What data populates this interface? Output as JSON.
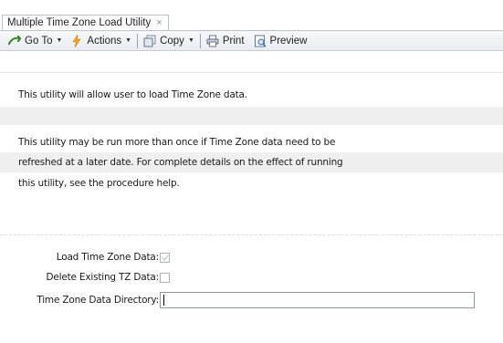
{
  "tab": {
    "title": "Multiple Time Zone Load Utility",
    "close_glyph": "×"
  },
  "toolbar": {
    "goto_label": "Go To",
    "actions_label": "Actions",
    "copy_label": "Copy",
    "print_label": "Print",
    "preview_label": "Preview"
  },
  "description": {
    "intro": "This utility will allow user to load Time Zone data.",
    "line1": "This utility may be run more than once if Time Zone data need to be",
    "line2": "refreshed at a later date. For complete details on the effect of running",
    "line3": "this utility, see the procedure help."
  },
  "form": {
    "load_tz_label": "Load Time Zone Data:",
    "load_tz_checked": true,
    "delete_tz_label": "Delete Existing TZ Data:",
    "delete_tz_checked": false,
    "directory_label": "Time Zone Data Directory:",
    "directory_value": ""
  },
  "colors": {
    "row_shade": "#efefef",
    "toolbar_bg": "#e9ecf1",
    "tab_border": "#b9c3cf"
  }
}
